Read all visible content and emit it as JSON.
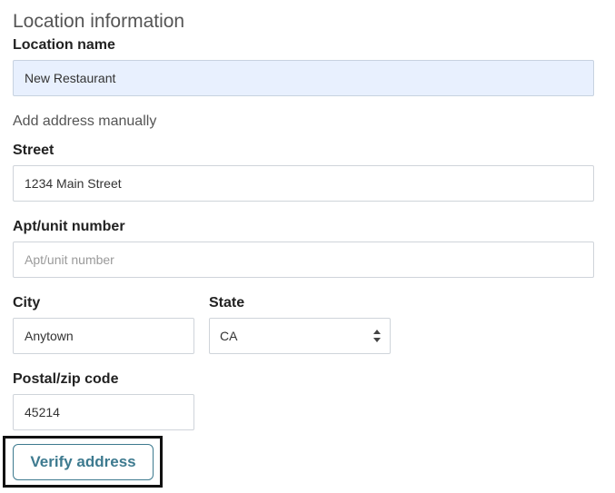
{
  "section": {
    "title": "Location information"
  },
  "location_name": {
    "label": "Location name",
    "value": "New Restaurant"
  },
  "manual": {
    "heading": "Add address manually"
  },
  "street": {
    "label": "Street",
    "value": "1234 Main Street"
  },
  "apt": {
    "label": "Apt/unit number",
    "placeholder": "Apt/unit number",
    "value": ""
  },
  "city": {
    "label": "City",
    "value": "Anytown"
  },
  "state": {
    "label": "State",
    "selected": "CA"
  },
  "postal": {
    "label": "Postal/zip code",
    "value": "45214"
  },
  "actions": {
    "verify_label": "Verify address"
  },
  "colors": {
    "accent": "#3d7a8f",
    "autofill_bg": "#e8f0fe",
    "highlight_border": "#111111"
  }
}
